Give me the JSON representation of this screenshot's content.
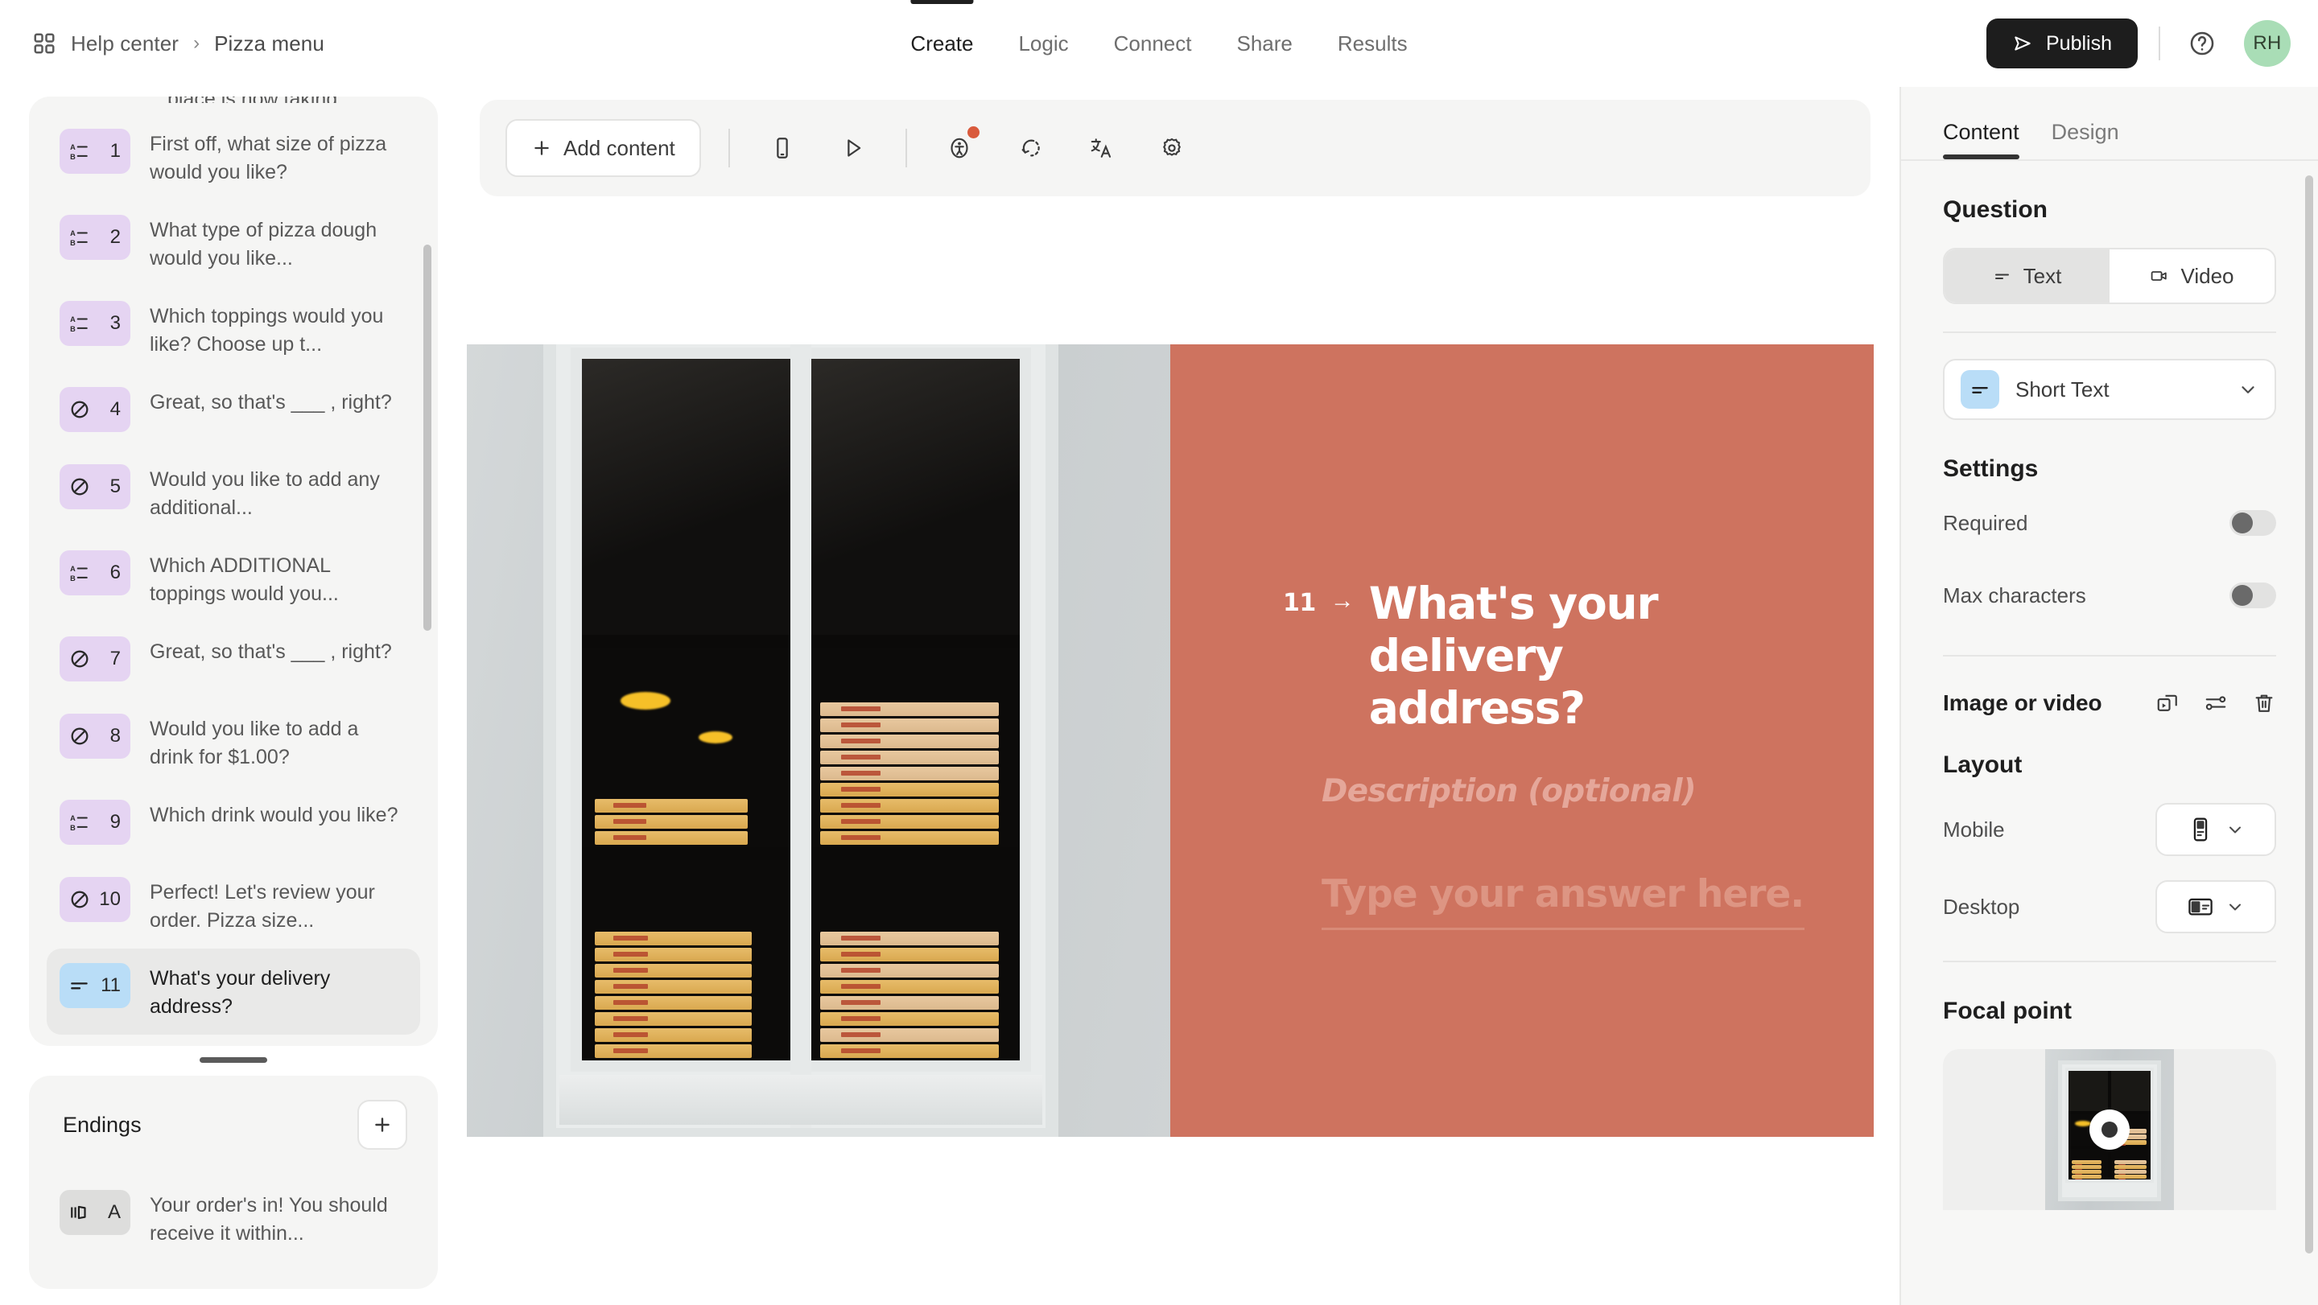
{
  "header": {
    "breadcrumb": {
      "home": "Help center",
      "separator": "›",
      "current": "Pizza menu"
    },
    "tabs": [
      {
        "label": "Create",
        "active": true
      },
      {
        "label": "Logic",
        "active": false
      },
      {
        "label": "Connect",
        "active": false
      },
      {
        "label": "Share",
        "active": false
      },
      {
        "label": "Results",
        "active": false
      }
    ],
    "publish_label": "Publish",
    "avatar_initials": "RH"
  },
  "sidebar": {
    "clipped_top_text": "place is now taking...",
    "questions": [
      {
        "num": "1",
        "type": "multiple-choice",
        "text": "First off, what size of pizza would you like?"
      },
      {
        "num": "2",
        "type": "multiple-choice",
        "text": "What type of pizza dough would you like..."
      },
      {
        "num": "3",
        "type": "multiple-choice",
        "text": "Which toppings would you like? Choose up t..."
      },
      {
        "num": "4",
        "type": "yes-no",
        "text": "Great, so that's ___ , right?"
      },
      {
        "num": "5",
        "type": "yes-no",
        "text": "Would you like to add any additional..."
      },
      {
        "num": "6",
        "type": "multiple-choice",
        "text": "Which ADDITIONAL toppings would you..."
      },
      {
        "num": "7",
        "type": "yes-no",
        "text": "Great, so that's ___ , right?"
      },
      {
        "num": "8",
        "type": "yes-no",
        "text": "Would you like to add a drink for $1.00?"
      },
      {
        "num": "9",
        "type": "multiple-choice",
        "text": "Which drink would you like?"
      },
      {
        "num": "10",
        "type": "yes-no",
        "text": "Perfect! Let's review your order. Pizza size..."
      },
      {
        "num": "11",
        "type": "short-text",
        "text": "What's your delivery address?",
        "selected": true
      }
    ],
    "endings": {
      "title": "Endings",
      "add_label": "+",
      "items": [
        {
          "num": "A",
          "type": "ending",
          "text": "Your order's in! You should receive it within..."
        }
      ]
    }
  },
  "toolbar": {
    "add_content_label": "Add content",
    "icons": [
      "mobile-preview-icon",
      "play-preview-icon",
      "accessibility-icon",
      "undo-icon",
      "translate-icon",
      "settings-gear-icon"
    ]
  },
  "preview": {
    "question_number": "11",
    "arrow": "→",
    "question_title": "What's your delivery address?",
    "description_placeholder": "Description (optional)",
    "answer_placeholder": "Type your answer here..",
    "panel_color": "#ce735f"
  },
  "right_panel": {
    "tabs": [
      {
        "label": "Content",
        "active": true
      },
      {
        "label": "Design",
        "active": false
      }
    ],
    "question": {
      "heading": "Question",
      "segmented": [
        {
          "label": "Text",
          "active": true
        },
        {
          "label": "Video",
          "active": false
        }
      ],
      "type_select": "Short Text"
    },
    "settings": {
      "heading": "Settings",
      "rows": [
        {
          "label": "Required",
          "value": "off"
        },
        {
          "label": "Max characters",
          "value": "off"
        }
      ]
    },
    "media": {
      "title": "Image or video",
      "icons": [
        "replace-media-icon",
        "adjust-media-icon",
        "delete-media-icon"
      ]
    },
    "layout": {
      "heading": "Layout",
      "rows": [
        {
          "label": "Mobile",
          "value": "stacked-layout"
        },
        {
          "label": "Desktop",
          "value": "split-left-layout"
        }
      ]
    },
    "focal_point": {
      "heading": "Focal point"
    }
  }
}
